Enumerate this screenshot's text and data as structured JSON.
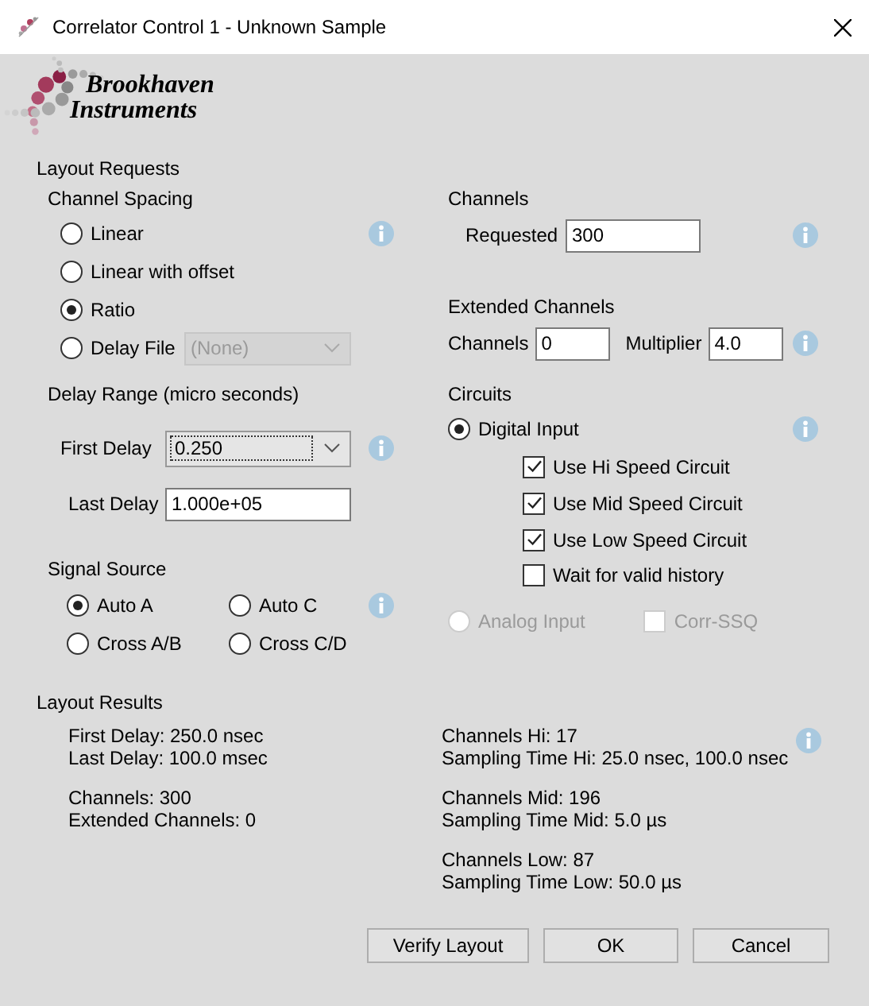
{
  "window": {
    "title": "Correlator Control 1 - Unknown Sample"
  },
  "logo": {
    "line1": "Brookhaven",
    "line2": "Instruments"
  },
  "layout_requests": {
    "title": "Layout Requests",
    "channel_spacing": {
      "title": "Channel Spacing",
      "options": [
        {
          "label": "Linear",
          "selected": false
        },
        {
          "label": "Linear with offset",
          "selected": false
        },
        {
          "label": "Ratio",
          "selected": true
        },
        {
          "label": "Delay File",
          "selected": false
        }
      ],
      "delay_file": {
        "value": "(None)",
        "disabled": true
      }
    },
    "delay_range": {
      "title": "Delay Range (micro seconds)",
      "first_delay": {
        "label": "First Delay",
        "value": "0.250"
      },
      "last_delay": {
        "label": "Last Delay",
        "value": "1.000e+05"
      }
    },
    "signal_source": {
      "title": "Signal Source",
      "options": [
        {
          "label": "Auto A",
          "selected": true
        },
        {
          "label": "Auto C",
          "selected": false
        },
        {
          "label": "Cross A/B",
          "selected": false
        },
        {
          "label": "Cross C/D",
          "selected": false
        }
      ]
    },
    "channels": {
      "title": "Channels",
      "requested": {
        "label": "Requested",
        "value": "300"
      }
    },
    "extended_channels": {
      "title": "Extended Channels",
      "channels": {
        "label": "Channels",
        "value": "0"
      },
      "multiplier": {
        "label": "Multiplier",
        "value": "4.0"
      }
    },
    "circuits": {
      "title": "Circuits",
      "digital_input": {
        "label": "Digital Input",
        "selected": true
      },
      "options": [
        {
          "label": "Use Hi Speed Circuit",
          "checked": true
        },
        {
          "label": "Use Mid Speed Circuit",
          "checked": true
        },
        {
          "label": "Use Low Speed Circuit",
          "checked": true
        },
        {
          "label": "Wait for valid history",
          "checked": false
        }
      ],
      "analog_input": {
        "label": "Analog Input",
        "selected": false,
        "disabled": true
      },
      "corr_ssq": {
        "label": "Corr-SSQ",
        "checked": false,
        "disabled": true
      }
    }
  },
  "layout_results": {
    "title": "Layout Results",
    "left": [
      [
        "First Delay: 250.0 nsec",
        "Last Delay: 100.0 msec"
      ],
      [
        "Channels: 300",
        "Extended Channels: 0"
      ]
    ],
    "right": [
      [
        "Channels Hi: 17",
        "Sampling Time Hi: 25.0 nsec, 100.0 nsec"
      ],
      [
        "Channels Mid: 196",
        "Sampling Time Mid: 5.0 µs"
      ],
      [
        "Channels Low: 87",
        "Sampling Time Low: 50.0 µs"
      ]
    ]
  },
  "buttons": [
    {
      "label": "Verify Layout"
    },
    {
      "label": "OK"
    },
    {
      "label": "Cancel"
    }
  ]
}
